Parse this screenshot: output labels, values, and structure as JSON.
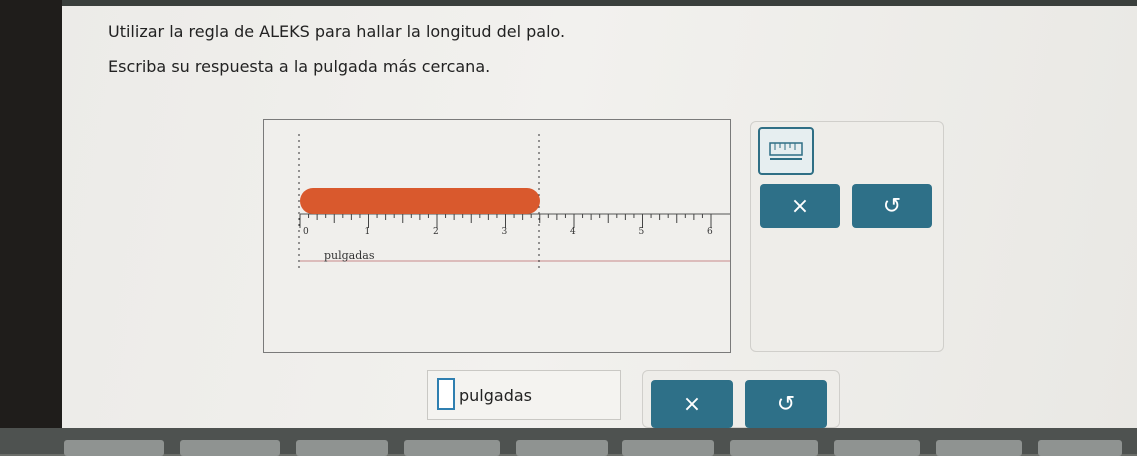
{
  "question": {
    "line1": "Utilizar la regla de ALEKS para hallar la longitud del palo.",
    "line2": "Escriba su respuesta a la pulgada más cercana."
  },
  "ruler": {
    "unit_label": "pulgadas",
    "tick_labels": [
      "0",
      "1",
      "2",
      "3",
      "4",
      "5",
      "6"
    ],
    "stick_color": "#d9592d"
  },
  "tools": {
    "clear_symbol": "×",
    "undo_symbol": "↺"
  },
  "answer": {
    "value": "",
    "unit": "pulgadas",
    "clear_symbol": "×",
    "undo_symbol": "↺"
  },
  "colors": {
    "button": "#2e7088",
    "accent": "#2f6f85"
  }
}
